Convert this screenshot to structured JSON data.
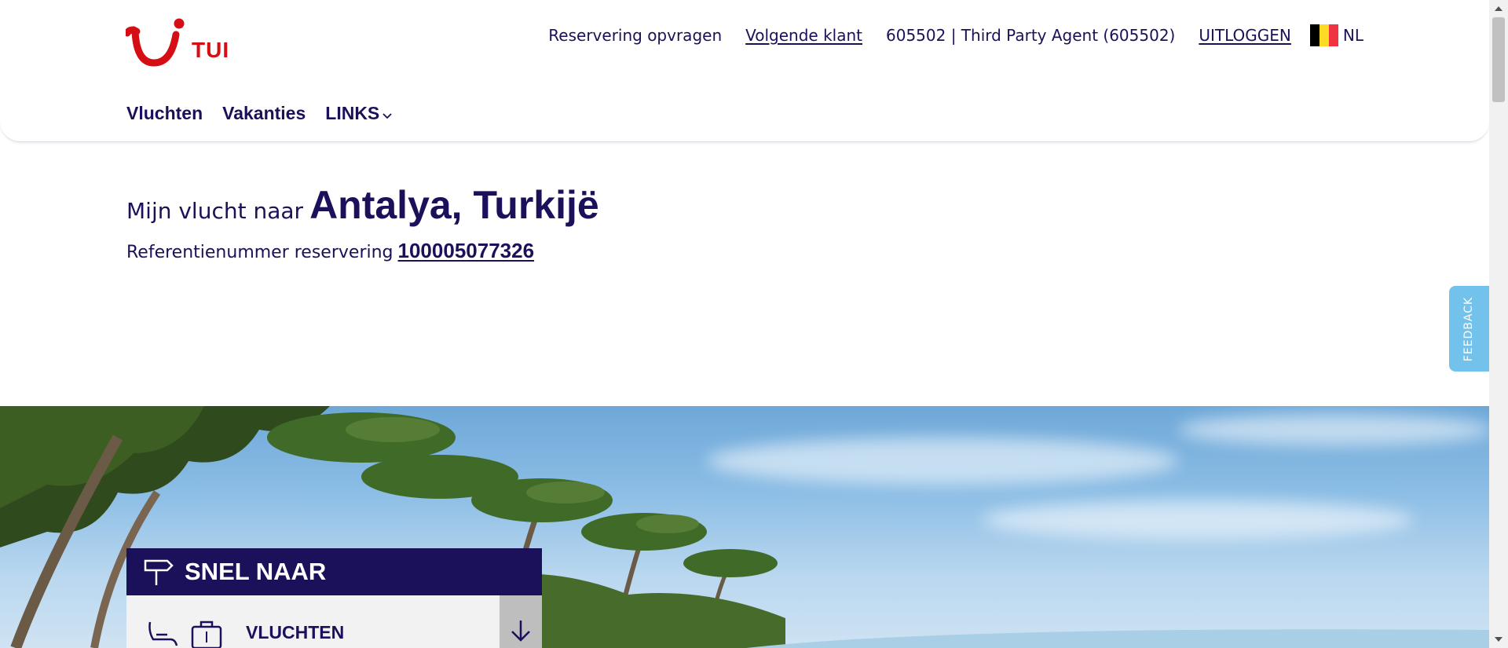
{
  "brand": {
    "name": "TUI",
    "color": "#d40e14",
    "navy": "#1a115a"
  },
  "topbar": {
    "request_reservation": "Reservering opvragen",
    "next_customer": "Volgende klant",
    "agent": "605502 | Third Party Agent (605502)",
    "logout": "UITLOGGEN",
    "language": "NL",
    "flag_colors": [
      "#000000",
      "#fdda24",
      "#ef3340"
    ]
  },
  "mainnav": {
    "items": [
      "Vluchten",
      "Vakanties",
      "LINKS"
    ]
  },
  "booking": {
    "title_prefix": "Mijn vlucht naar",
    "destination": "Antalya, Turkijë",
    "reference_label": "Referentienummer reservering",
    "reference_number": "100005077326"
  },
  "quick_nav": {
    "heading": "SNEL NAAR",
    "item_label": "VLUCHTEN",
    "icons": [
      "signpost-icon",
      "seat-icon",
      "luggage-icon",
      "arrow-down-icon"
    ]
  },
  "feedback": {
    "label": "FEEDBACK",
    "color": "#73c2eb"
  }
}
